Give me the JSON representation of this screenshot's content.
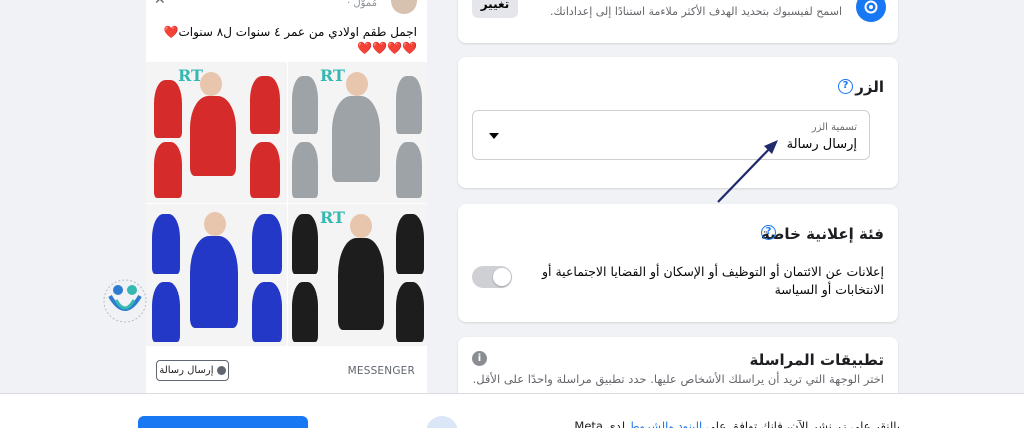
{
  "goal_card": {
    "description": "اسمح لفيسبوك بتحديد الهدف الأكثر ملاءمة استنادًا إلى إعداداتك.",
    "change_label": "تغيير",
    "icon": "goal-icon"
  },
  "button_section": {
    "title": "الزر",
    "help": "?",
    "field_label": "تسمية الزر",
    "field_value": "إرسال رسالة"
  },
  "special_category": {
    "title": "فئة إعلانية خاصة",
    "help": "?",
    "text": "إعلانات عن الائتمان أو التوظيف أو الإسكان أو القضايا الاجتماعية أو الانتخابات أو السياسة",
    "toggle_on": false
  },
  "messaging_apps": {
    "title": "تطبيقات المراسلة",
    "subtitle": "اختر الوجهة التي تريد أن يراسلك الأشخاص عليها. حدد تطبيق مراسلة واحدًا على الأقل.",
    "info": "i"
  },
  "preview": {
    "sponsored": "مُموّل ·",
    "post_text": "اجمل طقم اولادي من عمر ٤ سنوات ل٨ سنوات❤️❤️❤️❤️❤️",
    "watermark": "RT",
    "cta_source": "MESSENGER",
    "cta_button": "إرسال رسالة",
    "photos": [
      {
        "name": "photo-red-outfit",
        "color": "#d62b2b"
      },
      {
        "name": "photo-gray-outfit",
        "color": "#9ea3a8"
      },
      {
        "name": "photo-blue-outfit",
        "color": "#2338c6"
      },
      {
        "name": "photo-black-outfit",
        "color": "#1d1d1d"
      }
    ]
  },
  "bottom_bar": {
    "terms_prefix": "بالنقر على زر نشر الآن، فإنك توافق على",
    "terms_link": "البنود والشروط",
    "terms_suffix": "لدى Meta"
  }
}
